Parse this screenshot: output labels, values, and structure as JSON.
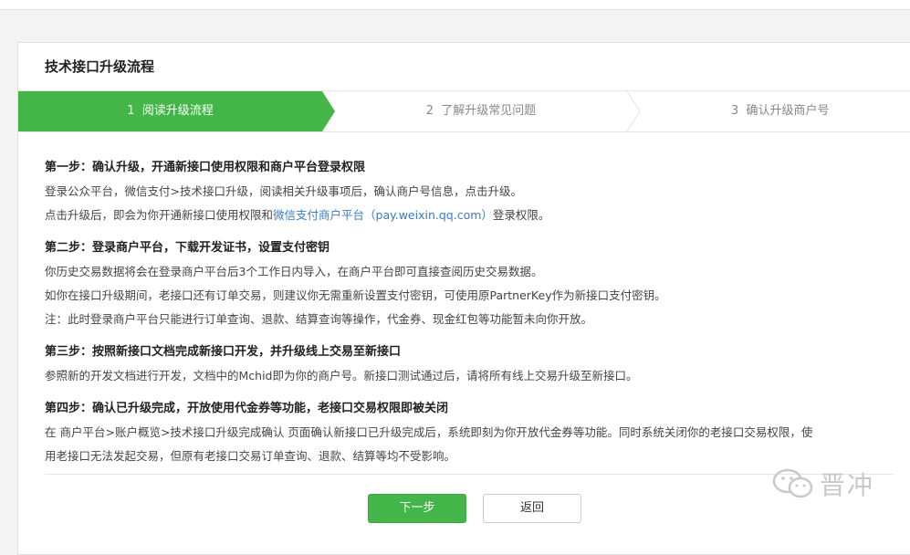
{
  "panel": {
    "title": "技术接口升级流程"
  },
  "steps": [
    {
      "num": "1",
      "label": "阅读升级流程",
      "active": true
    },
    {
      "num": "2",
      "label": "了解升级常见问题",
      "active": false
    },
    {
      "num": "3",
      "label": "确认升级商户号",
      "active": false
    }
  ],
  "sections": {
    "s1": {
      "title": "第一步：确认升级，开通新接口使用权限和商户平台登录权限",
      "line1": "登录公众平台，微信支付>技术接口升级，阅读相关升级事项后，确认商户号信息，点击升级。",
      "line2_pre": "点击升级后，即会为你开通新接口使用权限和",
      "line2_link": "微信支付商户平台（pay.weixin.qq.com）",
      "line2_post": "登录权限。"
    },
    "s2": {
      "title": "第二步：登录商户平台，下载开发证书，设置支付密钥",
      "line1": "你历史交易数据将会在登录商户平台后3个工作日内导入，在商户平台即可直接查阅历史交易数据。",
      "line2": "如你在接口升级期间，老接口还有订单交易，则建议你无需重新设置支付密钥，可使用原PartnerKey作为新接口支付密钥。",
      "line3": "注：此时登录商户平台只能进行订单查询、退款、结算查询等操作，代金券、现金红包等功能暂未向你开放。"
    },
    "s3": {
      "title": "第三步：按照新接口文档完成新接口开发，并升级线上交易至新接口",
      "line1": "参照新的开发文档进行开发，文档中的Mchid即为你的商户号。新接口测试通过后，请将所有线上交易升级至新接口。"
    },
    "s4": {
      "title": "第四步：确认已升级完成，开放使用代金券等功能，老接口交易权限即被关闭",
      "line1": "在 商户平台>账户概览>技术接口升级完成确认 页面确认新接口已升级完成后，系统即刻为你开放代金券等功能。同时系统关闭你的老接口交易权限，使",
      "line2": "用老接口无法发起交易，但原有老接口交易订单查询、退款、结算等均不受影响。"
    }
  },
  "buttons": {
    "next": "下一步",
    "back": "返回"
  },
  "watermark": {
    "text": "晋冲",
    "icon": "wechat-icon"
  },
  "colors": {
    "accent": "#44b549",
    "link": "#3a7bc8"
  }
}
